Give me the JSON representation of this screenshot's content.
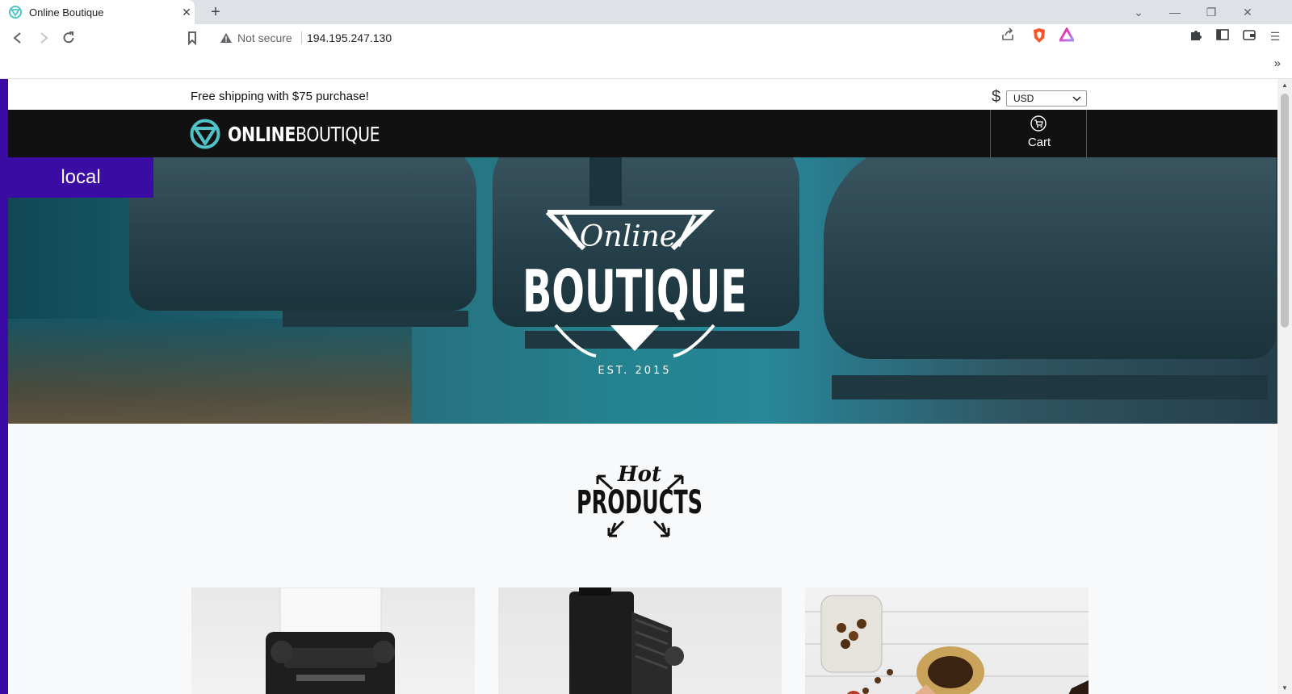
{
  "browser": {
    "tab_title": "Online Boutique",
    "new_tab_label": "+",
    "security_label": "Not secure",
    "url": "194.195.247.130"
  },
  "page": {
    "shipping_banner": "Free shipping with $75 purchase!",
    "currency_symbol": "$",
    "currency": {
      "selected": "USD",
      "options": [
        "USD"
      ]
    },
    "logo": {
      "text_bold": "ONLINE",
      "text_thin": "BOUTIQUE"
    },
    "cart_label": "Cart",
    "environment_badge": "local",
    "hero_logo": {
      "script": "Online",
      "main": "BOUTIQUE",
      "est": "EST. 2015"
    },
    "hot_products": {
      "script": "Hot",
      "main": "PRODUCTS"
    },
    "products": [
      {
        "name": "typewriter"
      },
      {
        "name": "camera"
      },
      {
        "name": "coffee"
      }
    ]
  },
  "colors": {
    "accent_purple": "#3a0ca3",
    "navbar": "#111111",
    "logo_teal": "#4fc3c8"
  }
}
